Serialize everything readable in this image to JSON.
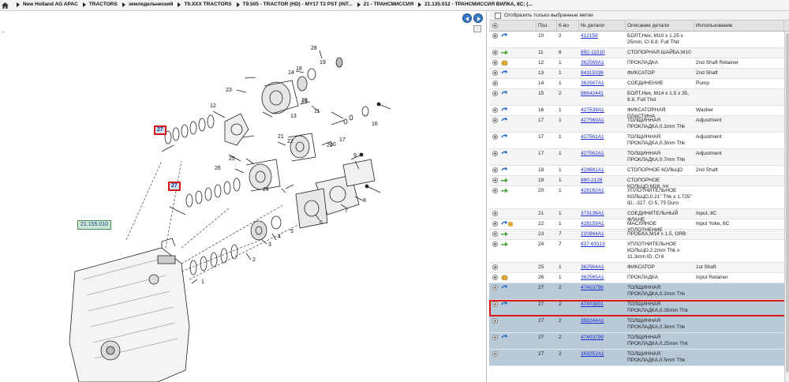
{
  "breadcrumb": [
    "New Holland AG APAC",
    "TRACTORS",
    "земледельческий",
    "T9.XXX TRACTORS",
    "T9.505 - TRACTOR (HD) - MY17 T2 PST (INT...",
    "21 - ТРАНСМИССИЯ",
    "21.135.012 - ТРАНСМИССИЯ ВИЛКА, 8C; (..."
  ],
  "filter_label": "Отобразить только выбранные метки",
  "columns": {
    "pos": "Поз.",
    "qty": "К-во",
    "pn": "№ детали",
    "desc": "Описание детали",
    "use": "Использование"
  },
  "diagram": {
    "callout_main": "21.155.010",
    "callout_27a": "27",
    "callout_27b": "27",
    "labels": {
      "n1": "1",
      "n2": "2",
      "n3": "3",
      "n4": "4",
      "n5": "5",
      "n6": "6",
      "n7": "7",
      "n8": "8",
      "n9": "9",
      "n10": "10",
      "n11": "11",
      "n12": "12",
      "n13": "13",
      "n14": "14",
      "n15": "15",
      "n16": "16",
      "n17": "17",
      "n18": "18",
      "n19": "19",
      "n20": "20",
      "n21": "21",
      "n22": "22",
      "n23": "23",
      "n24": "24",
      "n25": "25",
      "n26": "26",
      "n28": "28",
      "n29": "29"
    }
  },
  "rows": [
    {
      "pos": "10",
      "qty": "2",
      "pn": "412159",
      "desc": "БОЛТ,Hex, M10 x 1.25 x 25mm, Cl 8.8, Full Thd",
      "use": "",
      "icon": "blue",
      "h": 21
    },
    {
      "pos": "11",
      "qty": "6",
      "pn": "892-11010",
      "desc": "СТОПОРНАЯ ШАЙБА,M10",
      "use": "",
      "icon": "green",
      "h": 13,
      "alt": true
    },
    {
      "pos": "12",
      "qty": "1",
      "pn": "362569A1",
      "desc": "ПРОКЛАДКА",
      "use": "2nd Shaft Retainer",
      "icon": "box",
      "h": 13
    },
    {
      "pos": "13",
      "qty": "1",
      "pn": "84315336",
      "desc": "ФИКСАТОР",
      "use": "2nd Shaft",
      "icon": "blue",
      "h": 13,
      "alt": true
    },
    {
      "pos": "14",
      "qty": "1",
      "pn": "362567A1",
      "desc": "СОЕДИНЕНИЕ",
      "use": "Pump",
      "icon": "none",
      "h": 13
    },
    {
      "pos": "15",
      "qty": "2",
      "pn": "86642441",
      "desc": "БОЛТ,Hex, M14 x 1.5 x 35, 8.8, Full Thd",
      "use": "",
      "icon": "blue",
      "h": 21,
      "alt": true
    },
    {
      "pos": "16",
      "qty": "1",
      "pn": "427539A1",
      "desc": "ФИКСАТОРНАЯ ПЛАСТИНА",
      "use": "Washer",
      "icon": "blue",
      "h": 13
    },
    {
      "pos": "17",
      "qty": "1",
      "pn": "427560A1",
      "desc": "ТОЛЩИННАЯ ПРОКЛАДКА,0.1mm Thk",
      "use": "Adjustment",
      "icon": "blue",
      "h": 21,
      "alt": true
    },
    {
      "pos": "17",
      "qty": "1",
      "pn": "427561A1",
      "desc": "ТОЛЩИННАЯ ПРОКЛАДКА,0.3mm Thk",
      "use": "Adjustment",
      "icon": "blue",
      "h": 21
    },
    {
      "pos": "17",
      "qty": "1",
      "pn": "427562A1",
      "desc": "ТОЛЩИННАЯ ПРОКЛАДКА,0.7mm Thk",
      "use": "Adjustment",
      "icon": "blue",
      "h": 21,
      "alt": true
    },
    {
      "pos": "18",
      "qty": "1",
      "pn": "428681A1",
      "desc": "СТОПОРНОЕ КОЛЬЦО",
      "use": "2nd Shaft",
      "icon": "blue",
      "h": 13
    },
    {
      "pos": "19",
      "qty": "1",
      "pn": "880-2128",
      "desc": "СТОПОРНОЕ КОЛЬЦО,M28, Int",
      "use": "",
      "icon": "green",
      "h": 13,
      "alt": true
    },
    {
      "pos": "20",
      "qty": "1",
      "pn": "428162A1",
      "desc": "УПЛОТНИТЕЛЬНОЕ КОЛЬЦО,0.21\" Thk x 1.725\" ID, -327, Cl 5, 75 Duro",
      "use": "",
      "icon": "green",
      "h": 29
    },
    {
      "pos": "21",
      "qty": "1",
      "pn": "373136A1",
      "desc": "СОЕДИНИТЕЛЬНЫЙ ФЛАНЕ",
      "use": "Input, 8C",
      "icon": "none",
      "h": 13,
      "alt": true
    },
    {
      "pos": "22",
      "qty": "1",
      "pn": "428159A1",
      "desc": "МАСЛЯНОЕ УПЛОТНЕНИЕ",
      "use": "Input Yoke, 8C",
      "icon": "bluebox",
      "h": 13
    },
    {
      "pos": "23",
      "qty": "7",
      "pn": "220964A1",
      "desc": "ПРОБКА,M14 x 1.5, ORB",
      "use": "",
      "icon": "green",
      "h": 13,
      "alt": true
    },
    {
      "pos": "24",
      "qty": "7",
      "pn": "637-63113",
      "desc": "УПЛОТНИТЕЛЬНОЕ КОЛЬЦО,2.2mm Thk x 11.3mm ID, Cl 6",
      "use": "",
      "icon": "green",
      "h": 29
    },
    {
      "pos": "25",
      "qty": "1",
      "pn": "362564A1",
      "desc": "ФИКСАТОР",
      "use": "1st Shaft",
      "icon": "none",
      "h": 13,
      "alt": true
    },
    {
      "pos": "26",
      "qty": "1",
      "pn": "362565A1",
      "desc": "ПРОКЛАДКА",
      "use": "Input Retainer",
      "icon": "box",
      "h": 13
    },
    {
      "pos": "27",
      "qty": "2",
      "pn": "47403798",
      "desc": "ТОЛЩИННАЯ ПРОКЛАДКА,0.2mm Thk",
      "use": "",
      "icon": "blue",
      "h": 21,
      "sel": true
    },
    {
      "pos": "27",
      "qty": "2",
      "pn": "47403801",
      "desc": "ТОЛЩИННАЯ ПРОКЛАДКА,0.35mm Thk",
      "use": "",
      "icon": "blue",
      "h": 21,
      "sel": true,
      "hl": true
    },
    {
      "pos": "27",
      "qty": "2",
      "pn": "359244A1",
      "desc": "ТОЛЩИННАЯ ПРОКЛАДКА,0.3mm Thk",
      "use": "",
      "icon": "none",
      "h": 21,
      "sel": true
    },
    {
      "pos": "27",
      "qty": "2",
      "pn": "47403799",
      "desc": "ТОЛЩИННАЯ ПРОКЛАДКА,0.25mm Thk",
      "use": "",
      "icon": "blue",
      "h": 21,
      "sel": true
    },
    {
      "pos": "27",
      "qty": "2",
      "pn": "359251A1",
      "desc": "ТОЛЩИННАЯ ПРОКЛАДКА,0.5mm Thk",
      "use": "",
      "icon": "none",
      "h": 21,
      "sel": true
    }
  ]
}
